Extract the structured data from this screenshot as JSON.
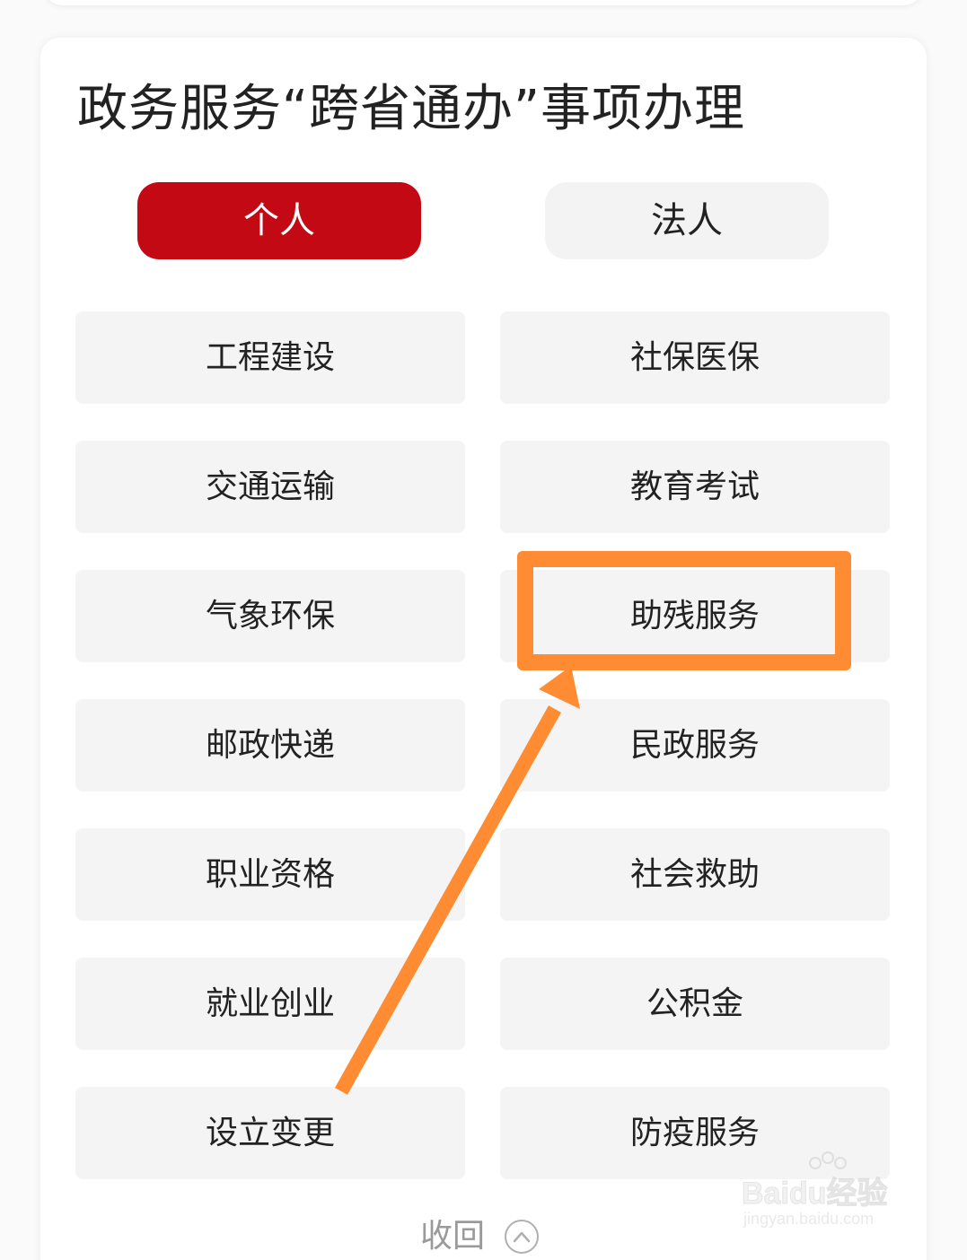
{
  "section": {
    "title": "政务服务“跨省通办”事项办理"
  },
  "tabs": [
    {
      "label": "个人",
      "active": true
    },
    {
      "label": "法人",
      "active": false
    }
  ],
  "categories": [
    {
      "label": "工程建设"
    },
    {
      "label": "社保医保"
    },
    {
      "label": "交通运输"
    },
    {
      "label": "教育考试"
    },
    {
      "label": "气象环保"
    },
    {
      "label": "助残服务"
    },
    {
      "label": "邮政快递"
    },
    {
      "label": "民政服务"
    },
    {
      "label": "职业资格"
    },
    {
      "label": "社会救助"
    },
    {
      "label": "就业创业"
    },
    {
      "label": "公积金"
    },
    {
      "label": "设立变更"
    },
    {
      "label": "防疫服务"
    }
  ],
  "collapse": {
    "label": "收回",
    "icon": "chevron-up-icon"
  },
  "annotation": {
    "highlighted_item": "助残服务",
    "color": "#ff8c33"
  },
  "watermark": {
    "brand": "Baidu经验",
    "url": "jingyan.baidu.com"
  },
  "colors": {
    "active_tab": "#c30a14",
    "inactive_tab": "#f3f3f3",
    "tile": "#f4f4f4"
  }
}
